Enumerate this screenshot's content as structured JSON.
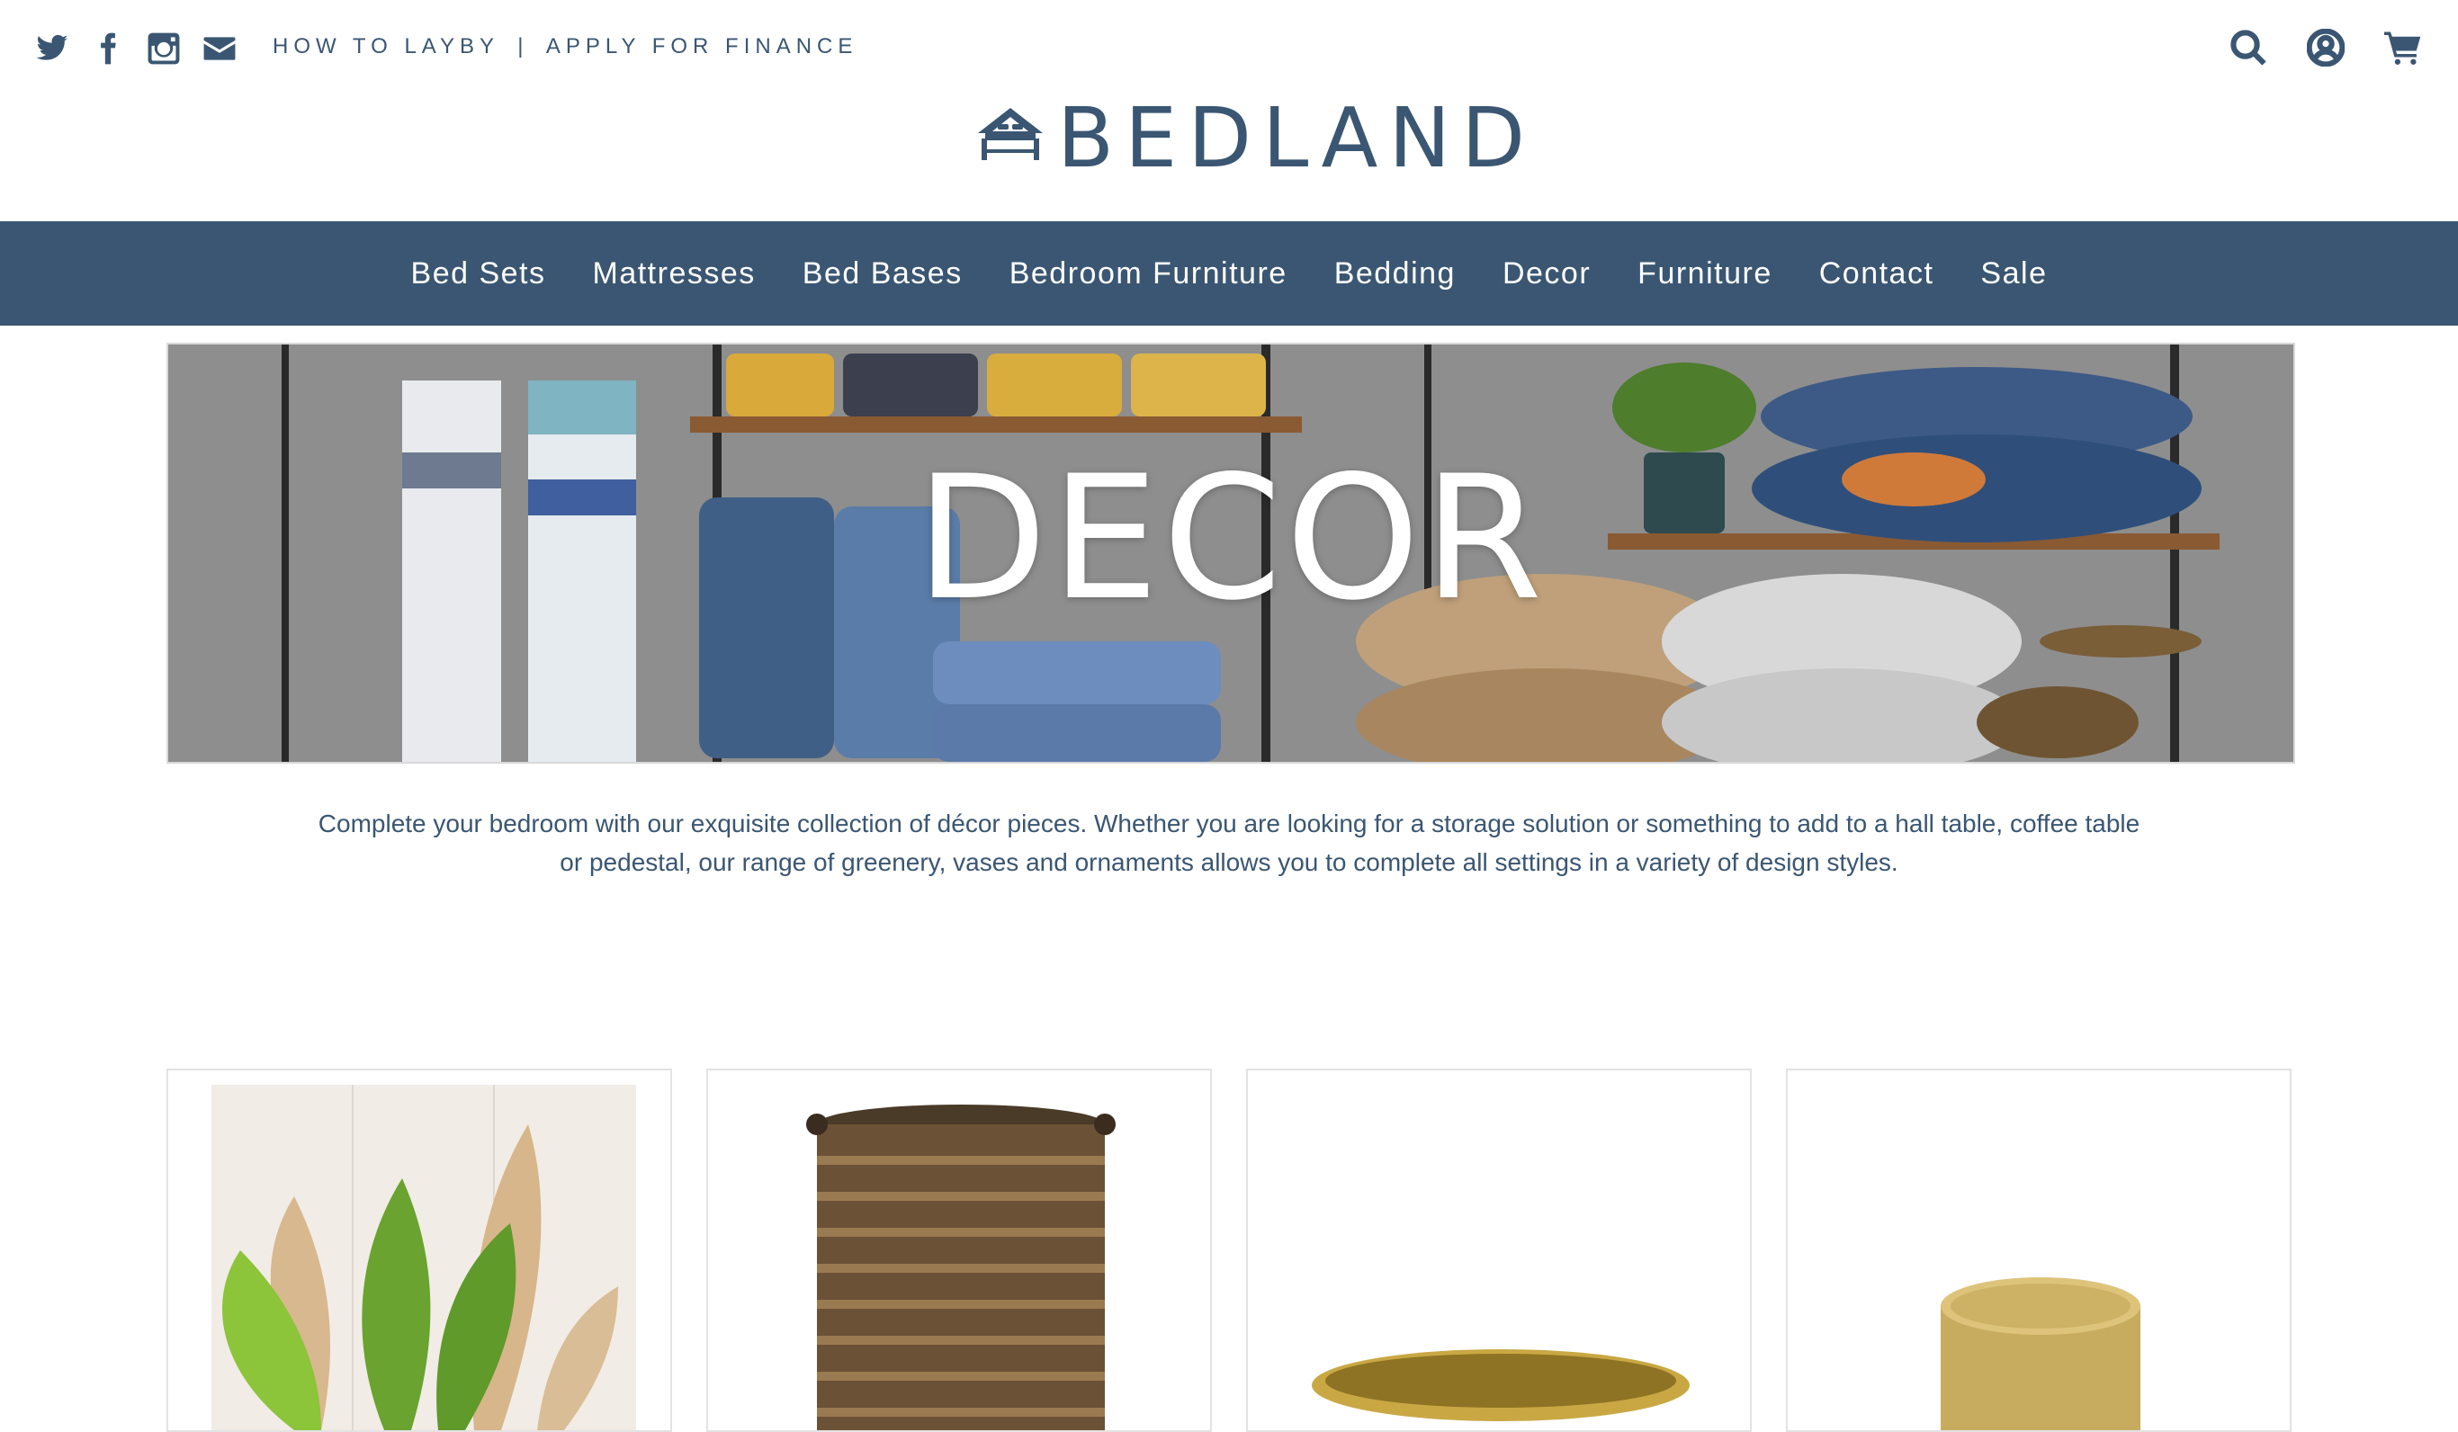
{
  "utility_links": {
    "layby": "HOW TO LAYBY",
    "separator": "|",
    "finance": "APPLY FOR FINANCE"
  },
  "social_icons": [
    "twitter-icon",
    "facebook-icon",
    "instagram-icon",
    "email-icon"
  ],
  "header_icons": [
    "search-icon",
    "account-icon",
    "cart-icon"
  ],
  "logo": {
    "text": "BEDLAND"
  },
  "nav": {
    "items": [
      "Bed Sets",
      "Mattresses",
      "Bed Bases",
      "Bedroom Furniture",
      "Bedding",
      "Decor",
      "Furniture",
      "Contact",
      "Sale"
    ]
  },
  "hero": {
    "title": "DECOR"
  },
  "description": {
    "line1": "Complete your bedroom with our exquisite collection of décor pieces. Whether you are looking for a storage solution or something to add to a hall table, coffee table",
    "line2": "or pedestal, our range of greenery, vases and ornaments allows you to complete all settings in a variety of design styles."
  },
  "products": [
    {
      "image": "leaf-wall-art"
    },
    {
      "image": "woven-basket"
    },
    {
      "image": "brass-bowl"
    },
    {
      "image": "brass-side-table"
    }
  ],
  "colors": {
    "brand": "#3a5672",
    "nav_bg": "#3a5672",
    "nav_text": "#ffffff"
  }
}
